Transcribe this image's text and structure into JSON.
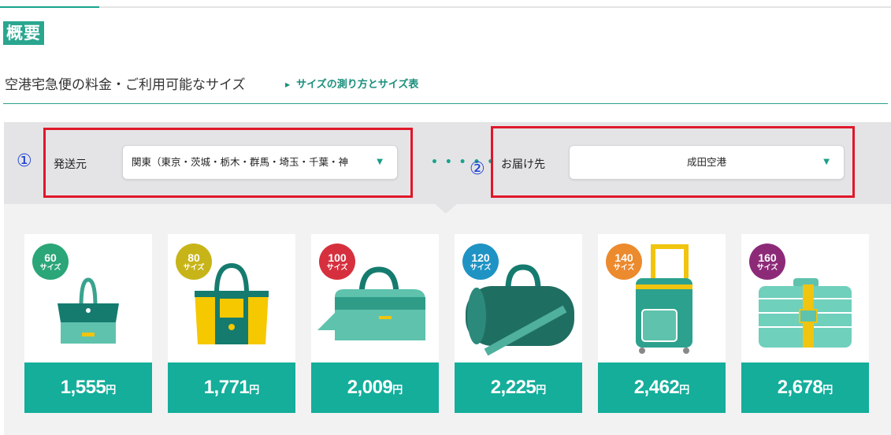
{
  "section_title": "概要",
  "subheader": {
    "title": "空港宅急便の料金・ご利用可能なサイズ",
    "size_link": "サイズの測り方とサイズ表"
  },
  "origin": {
    "marker": "①",
    "label": "発送元",
    "value": "関東（東京・茨城・栃木・群馬・埼玉・千葉・神"
  },
  "destination": {
    "marker": "②",
    "label": "お届け先",
    "value": "成田空港"
  },
  "connector": "• • • • •",
  "size_unit": "サイズ",
  "yen": "円",
  "sizes": [
    {
      "size": "60",
      "price": "1,555",
      "color": "#2aa678"
    },
    {
      "size": "80",
      "price": "1,771",
      "color": "#c7b418"
    },
    {
      "size": "100",
      "price": "2,009",
      "color": "#d6303e"
    },
    {
      "size": "120",
      "price": "2,225",
      "color": "#1f93c4"
    },
    {
      "size": "140",
      "price": "2,462",
      "color": "#ec8a2e"
    },
    {
      "size": "160",
      "price": "2,678",
      "color": "#8d2a78"
    }
  ],
  "colors": {
    "accent": "#1aa38c",
    "price_bar": "#14ae9b",
    "highlight_box": "#e0172a",
    "marker_blue": "#1a3fd6"
  }
}
